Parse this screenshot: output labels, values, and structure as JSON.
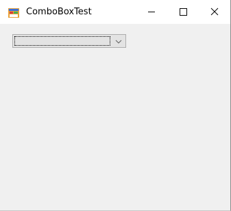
{
  "window": {
    "title": "ComboBoxTest",
    "icon": "app-window-icon",
    "controls": {
      "minimize_icon": "minimize-icon",
      "maximize_icon": "maximize-icon",
      "close_icon": "close-icon"
    }
  },
  "combobox": {
    "selected_value": "",
    "arrow_icon": "chevron-down-icon",
    "colors": {
      "background": "#e3e3e3",
      "border": "#adadad"
    }
  },
  "colors": {
    "titlebar": "#ffffff",
    "client_background": "#f0f0f0"
  }
}
